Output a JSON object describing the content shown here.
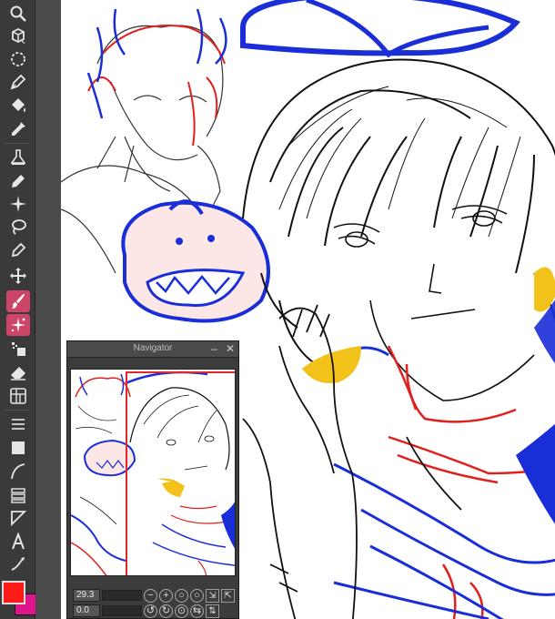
{
  "toolbar": {
    "tools": [
      {
        "name": "zoom-tool",
        "icon": "magnifier-icon"
      },
      {
        "name": "object-tool",
        "icon": "operation-icon"
      },
      {
        "name": "lasso-select-tool",
        "icon": "lasso-icon"
      },
      {
        "name": "pen-tool",
        "icon": "pen-icon"
      },
      {
        "name": "fill-tool",
        "icon": "bucket-icon"
      },
      {
        "name": "eyedropper-tool",
        "icon": "eyedropper-icon"
      },
      {
        "name": "blend-tool",
        "icon": "blend-icon"
      },
      {
        "name": "pencil-tool",
        "icon": "pencil-icon"
      },
      {
        "name": "decoration-tool",
        "icon": "sparkle-icon"
      },
      {
        "name": "auto-select-tool",
        "icon": "auto-select-icon"
      },
      {
        "name": "marker-tool",
        "icon": "marker-icon"
      },
      {
        "name": "move-tool",
        "icon": "move-icon"
      },
      {
        "name": "brush-tool",
        "icon": "brush-icon",
        "active": true
      },
      {
        "name": "airbrush-tool",
        "icon": "airbrush-icon",
        "active": true
      },
      {
        "name": "gradient-tool",
        "icon": "gradient-icon"
      },
      {
        "name": "eraser-tool",
        "icon": "eraser-icon"
      },
      {
        "name": "frame-tool",
        "icon": "frame-icon"
      },
      {
        "name": "ruler-tool",
        "icon": "ruler-icon"
      },
      {
        "name": "figure-tool",
        "icon": "rectangle-icon"
      },
      {
        "name": "curve-tool",
        "icon": "curve-icon"
      },
      {
        "name": "balloon-tool",
        "icon": "balloon-icon"
      },
      {
        "name": "text-tool",
        "icon": "text-icon"
      },
      {
        "name": "correct-line-tool",
        "icon": "correct-line-icon"
      }
    ],
    "main_color": "#ff1a1a",
    "sub_color": "#e0148c"
  },
  "navigator": {
    "title": "Navigator",
    "zoom_value": "29.3",
    "rotation_value": "0.0",
    "frame_color": "#e0282c"
  }
}
